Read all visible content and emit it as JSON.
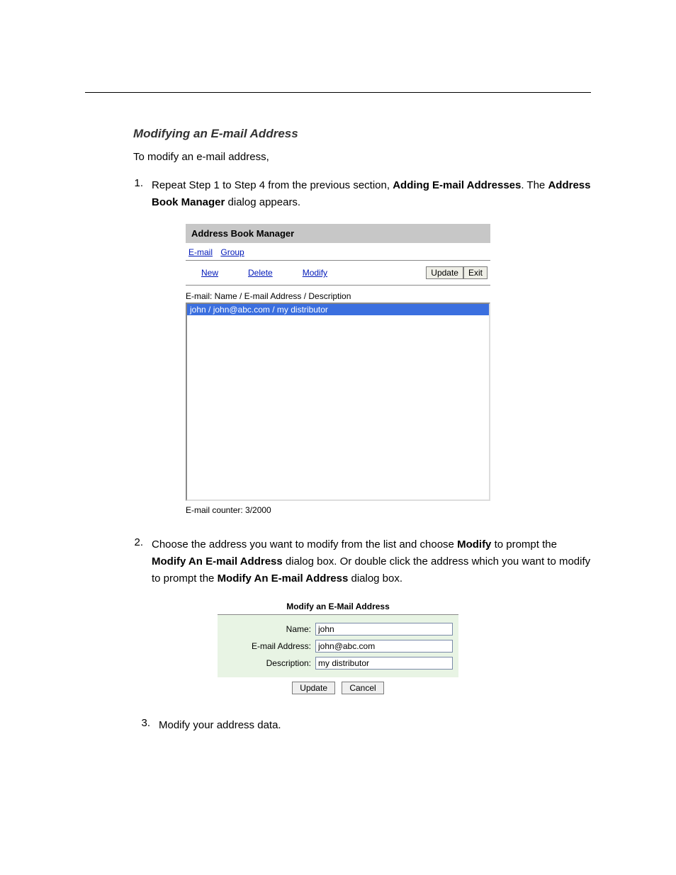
{
  "section": {
    "title": "Modifying an E-mail Address",
    "intro": "To modify an e-mail address,"
  },
  "steps": {
    "s1": {
      "num": "1.",
      "t1": "Repeat Step 1 to Step 4 from the previous section, ",
      "bold1": "Adding E-mail Addresses",
      "t2": ".  The ",
      "bold2": "Address Book Manager",
      "t3": " dialog appears."
    },
    "s2": {
      "num": "2.",
      "t1": "Choose the address you want to modify from the list and choose ",
      "bold1": "Modify",
      "t2": " to prompt the ",
      "bold2": "Modify An E-mail Address",
      "t3": " dialog box.   Or double click the address which you want to modify to prompt the ",
      "bold3": "Modify An E-mail Address",
      "t4": " dialog box."
    },
    "s3": {
      "num": "3.",
      "t1": "Modify your address data."
    }
  },
  "abm": {
    "title": "Address Book Manager",
    "tab_email": "E-mail",
    "tab_group": "Group",
    "link_new": "New",
    "link_delete": "Delete",
    "link_modify": "Modify",
    "btn_update": "Update",
    "btn_exit": "Exit",
    "list_label": "E-mail: Name / E-mail Address / Description",
    "row1": "john / john@abc.com / my distributor",
    "counter": "E-mail counter: 3/2000"
  },
  "mod": {
    "title": "Modify an E-Mail Address",
    "label_name": "Name:",
    "label_email": "E-mail Address:",
    "label_desc": "Description:",
    "val_name": "john",
    "val_email": "john@abc.com",
    "val_desc": "my distributor",
    "btn_update": "Update",
    "btn_cancel": "Cancel"
  }
}
